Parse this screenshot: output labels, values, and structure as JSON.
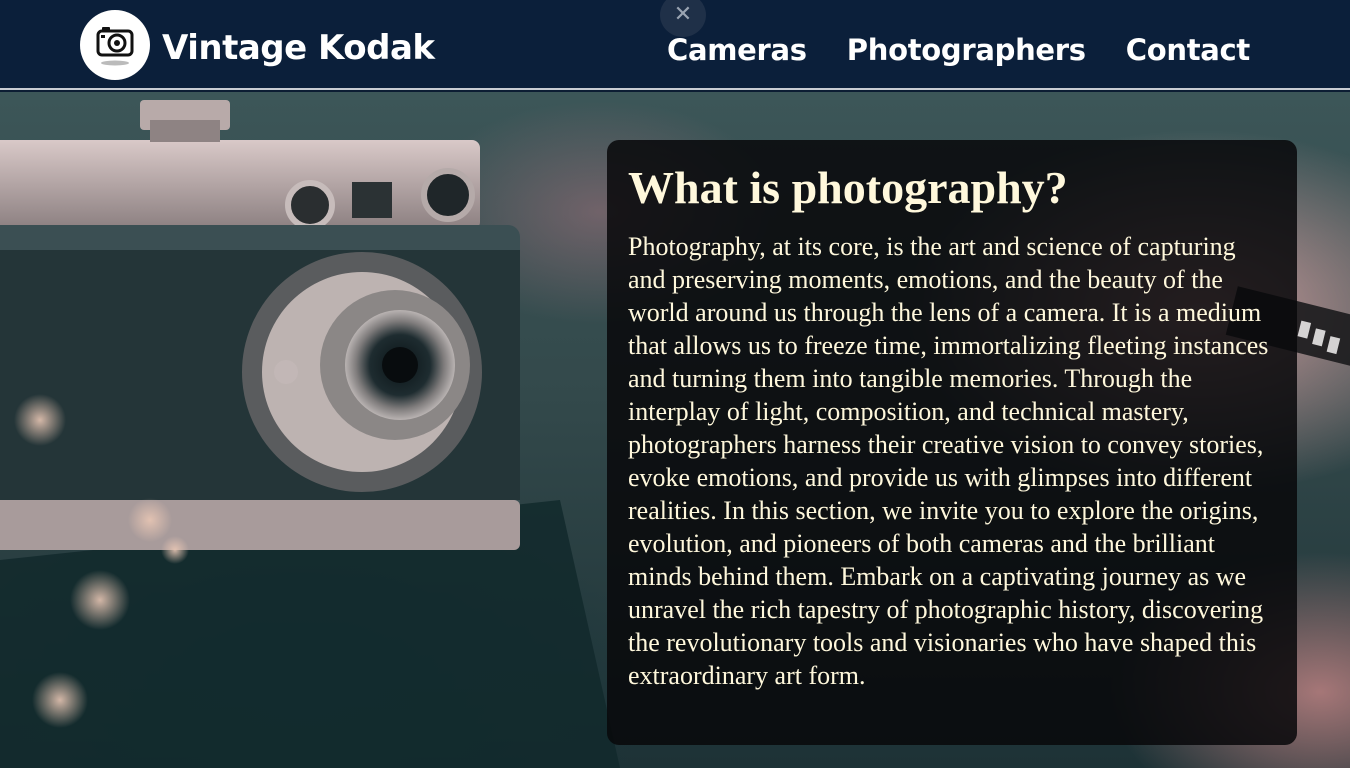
{
  "header": {
    "brand": "Vintage Kodak",
    "logo_icon": "camera-icon",
    "close_glyph": "✕",
    "nav": [
      {
        "label": "Cameras"
      },
      {
        "label": "Photographers"
      },
      {
        "label": "Contact"
      }
    ]
  },
  "hero": {
    "image": "vintage-camera-photo",
    "heading": "What is photography?",
    "body": "Photography, at its core, is the art and science of capturing and preserving moments, emotions, and the beauty of the world around us through the lens of a camera. It is a medium that allows us to freeze time, immortalizing fleeting instances and turning them into tangible memories. Through the interplay of light, composition, and technical mastery, photographers harness their creative vision to convey stories, evoke emotions, and provide us with glimpses into different realities. In this section, we invite you to explore the origins, evolution, and pioneers of both cameras and the brilliant minds behind them. Embark on a captivating journey as we unravel the rich tapestry of photographic history, discovering the revolutionary tools and visionaries who have shaped this extraordinary art form."
  },
  "colors": {
    "navbar": "#0b1f3a",
    "nav_text": "#ffffff",
    "card_bg": "#08080a",
    "card_text": "#fff8dc"
  }
}
